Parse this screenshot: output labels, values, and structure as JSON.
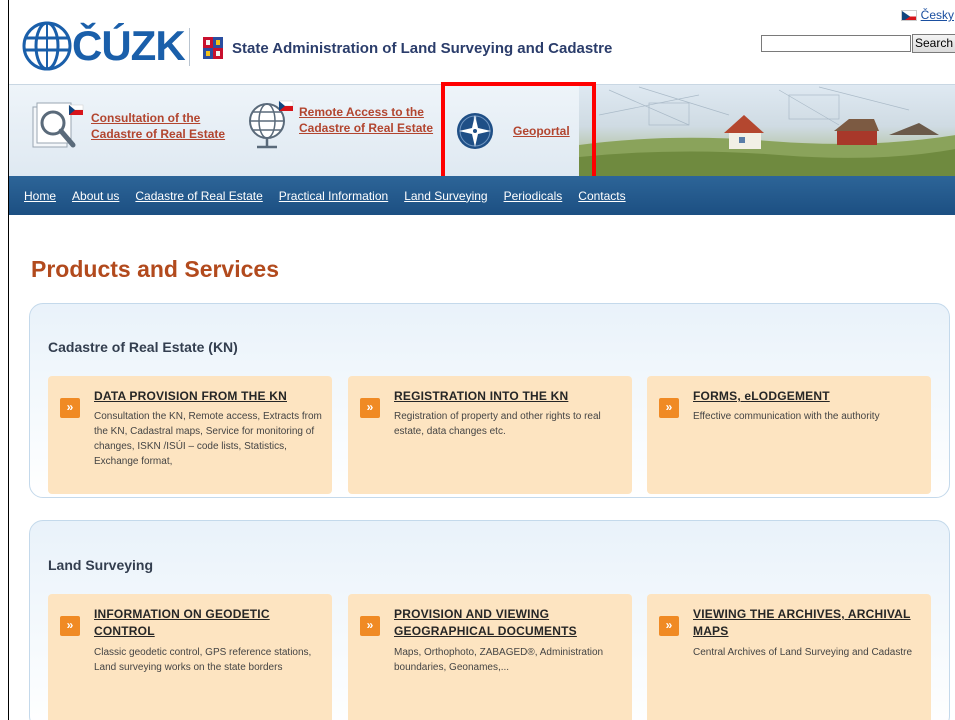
{
  "header": {
    "logo_text": "ČÚZK",
    "site_title": "State Administration of Land Surveying and Cadastre",
    "lang_label": "Česky",
    "search_placeholder": "",
    "search_button": "Search"
  },
  "banner": {
    "items": [
      {
        "label_line1": "Consultation of the",
        "label_line2": "Cadastre of Real Estate",
        "icon": "magnifier-icon"
      },
      {
        "label_line1": "Remote Access to the",
        "label_line2": "Cadastre of Real Estate",
        "icon": "globe-icon"
      },
      {
        "label_line1": "Geoportal",
        "label_line2": "",
        "icon": "compass-icon"
      }
    ]
  },
  "nav": {
    "items": [
      "Home",
      "About us",
      "Cadastre of Real Estate",
      "Practical Information",
      "Land Surveying",
      "Periodicals",
      "Contacts"
    ]
  },
  "main": {
    "title": "Products and Services",
    "sections": [
      {
        "title": "Cadastre of Real Estate (KN)",
        "cards": [
          {
            "title": "DATA PROVISION FROM THE KN",
            "desc": "Consultation the KN, Remote access, Extracts from the KN, Cadastral maps, Service for monitoring of changes, ISKN /ISÚI – code lists, Statistics, Exchange format,"
          },
          {
            "title": "REGISTRATION INTO THE KN",
            "desc": "Registration of property and other rights to real estate, data changes etc."
          },
          {
            "title": "FORMS, eLODGEMENT",
            "desc": "Effective communication with the authority"
          }
        ]
      },
      {
        "title": "Land Surveying",
        "cards": [
          {
            "title": "INFORMATION ON GEODETIC CONTROL",
            "desc": "Classic geodetic control, GPS reference stations, Land surveying works on the state borders"
          },
          {
            "title": "PROVISION AND VIEWING GEOGRAPHICAL DOCUMENTS",
            "desc": "Maps, Orthophoto, ZABAGED®, Administration boundaries, Geonames,..."
          },
          {
            "title": "VIEWING THE ARCHIVES, ARCHIVAL MAPS",
            "desc": "Central Archives of Land Surveying and Cadastre"
          }
        ]
      }
    ]
  },
  "colors": {
    "brand_blue": "#1a5faa",
    "nav_blue": "#1c4f82",
    "link_red": "#b2452f",
    "card_bg": "#fde4c1",
    "arrow_orange": "#f08a24",
    "highlight_red": "#ff0000"
  }
}
